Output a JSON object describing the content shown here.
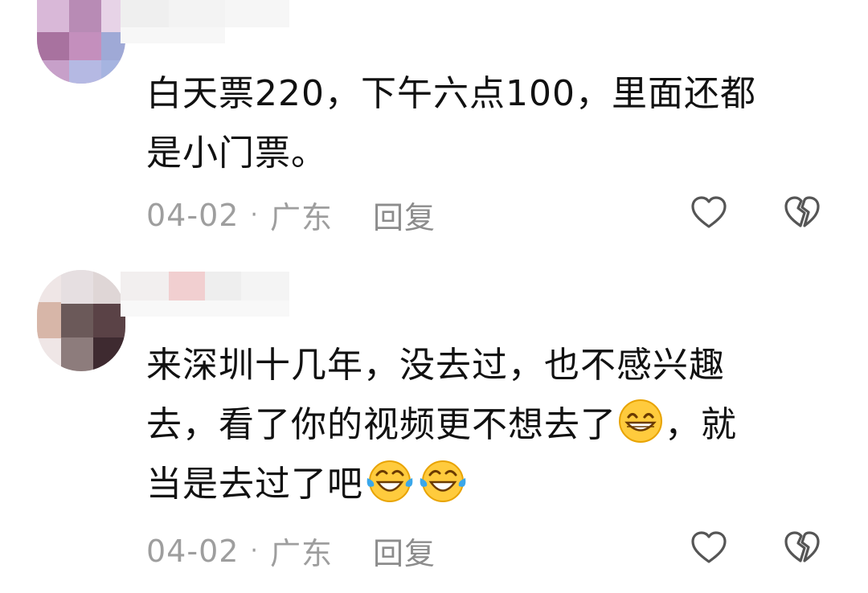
{
  "comments": [
    {
      "text_lines": [
        "白天票220，下午六点100，里面还都",
        "是小门票。"
      ],
      "date": "04-02",
      "separator": "·",
      "location": "广东",
      "reply_label": "回复"
    },
    {
      "text_lines": [
        "来深圳十几年，没去过，也不感兴趣",
        "去，看了你的视频更不想去了",
        "，就",
        "当是去过了吧"
      ],
      "date": "04-02",
      "separator": "·",
      "location": "广东",
      "reply_label": "回复"
    }
  ],
  "icons": {
    "like": "heart-outline-icon",
    "dislike": "broken-heart-outline-icon",
    "emoji_grin": "grinning-face-emoji",
    "emoji_laugh": "rolling-laughing-tears-emoji"
  },
  "colors": {
    "text": "#111111",
    "meta": "#9e9e9e",
    "icon": "#555555"
  }
}
